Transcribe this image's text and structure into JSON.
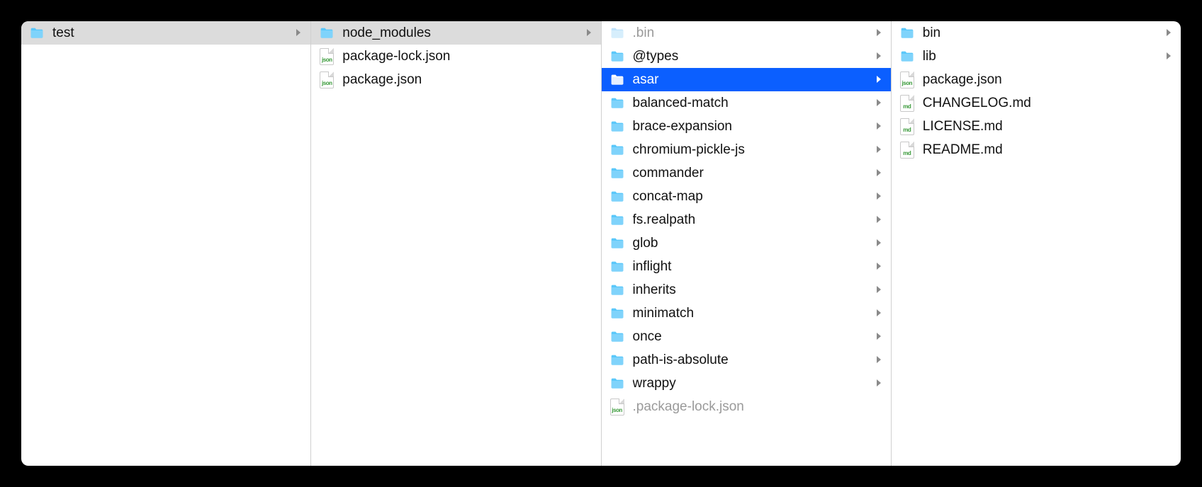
{
  "columns": [
    {
      "items": [
        {
          "name": "test",
          "type": "folder",
          "selected": "path",
          "hasChildren": true
        }
      ]
    },
    {
      "items": [
        {
          "name": "node_modules",
          "type": "folder",
          "selected": "path",
          "hasChildren": true
        },
        {
          "name": "package-lock.json",
          "type": "file",
          "ext": "json"
        },
        {
          "name": "package.json",
          "type": "file",
          "ext": "json"
        }
      ]
    },
    {
      "items": [
        {
          "name": ".bin",
          "type": "folder",
          "dimmed": true,
          "hasChildren": true
        },
        {
          "name": "@types",
          "type": "folder",
          "hasChildren": true
        },
        {
          "name": "asar",
          "type": "folder",
          "selected": "active",
          "hasChildren": true
        },
        {
          "name": "balanced-match",
          "type": "folder",
          "hasChildren": true
        },
        {
          "name": "brace-expansion",
          "type": "folder",
          "hasChildren": true
        },
        {
          "name": "chromium-pickle-js",
          "type": "folder",
          "hasChildren": true
        },
        {
          "name": "commander",
          "type": "folder",
          "hasChildren": true
        },
        {
          "name": "concat-map",
          "type": "folder",
          "hasChildren": true
        },
        {
          "name": "fs.realpath",
          "type": "folder",
          "hasChildren": true
        },
        {
          "name": "glob",
          "type": "folder",
          "hasChildren": true
        },
        {
          "name": "inflight",
          "type": "folder",
          "hasChildren": true
        },
        {
          "name": "inherits",
          "type": "folder",
          "hasChildren": true
        },
        {
          "name": "minimatch",
          "type": "folder",
          "hasChildren": true
        },
        {
          "name": "once",
          "type": "folder",
          "hasChildren": true
        },
        {
          "name": "path-is-absolute",
          "type": "folder",
          "hasChildren": true
        },
        {
          "name": "wrappy",
          "type": "folder",
          "hasChildren": true
        },
        {
          "name": ".package-lock.json",
          "type": "file",
          "ext": "json",
          "dimmed": true
        }
      ]
    },
    {
      "items": [
        {
          "name": "bin",
          "type": "folder",
          "hasChildren": true
        },
        {
          "name": "lib",
          "type": "folder",
          "hasChildren": true
        },
        {
          "name": "package.json",
          "type": "file",
          "ext": "json"
        },
        {
          "name": "CHANGELOG.md",
          "type": "file",
          "ext": "md"
        },
        {
          "name": "LICENSE.md",
          "type": "file",
          "ext": "md"
        },
        {
          "name": "README.md",
          "type": "file",
          "ext": "md"
        }
      ]
    }
  ]
}
